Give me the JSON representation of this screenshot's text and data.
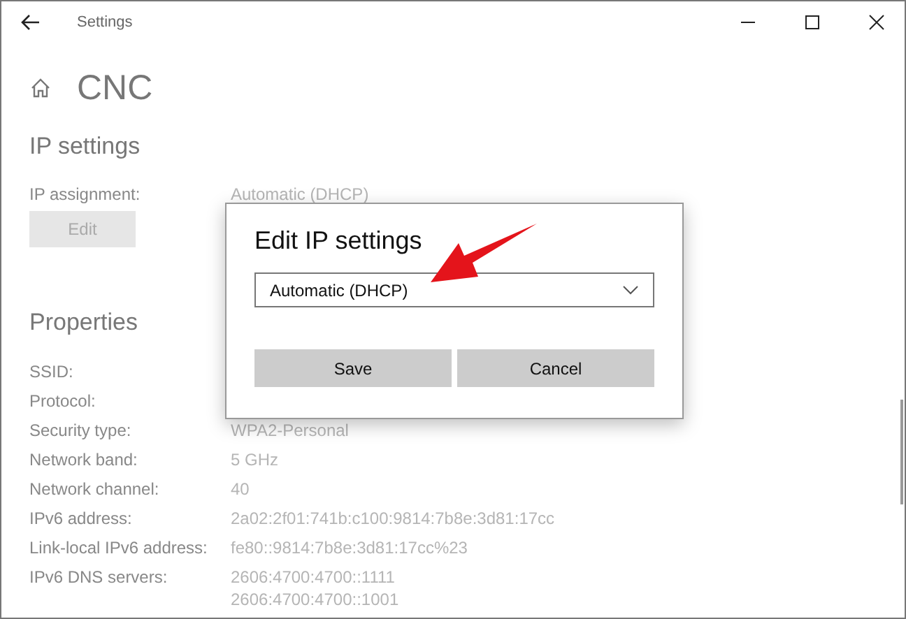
{
  "window": {
    "title": "Settings"
  },
  "page": {
    "title": "CNC"
  },
  "ip_settings": {
    "heading": "IP settings",
    "label": "IP assignment:",
    "value": "Automatic (DHCP)",
    "edit_button": "Edit"
  },
  "properties": {
    "heading": "Properties",
    "rows": [
      {
        "label": "SSID:",
        "values": []
      },
      {
        "label": "Protocol:",
        "values": []
      },
      {
        "label": "Security type:",
        "values": [
          "WPA2-Personal"
        ]
      },
      {
        "label": "Network band:",
        "values": [
          "5 GHz"
        ]
      },
      {
        "label": "Network channel:",
        "values": [
          "40"
        ]
      },
      {
        "label": "IPv6 address:",
        "values": [
          "2a02:2f01:741b:c100:9814:7b8e:3d81:17cc"
        ]
      },
      {
        "label": "Link-local IPv6 address:",
        "values": [
          "fe80::9814:7b8e:3d81:17cc%23"
        ]
      },
      {
        "label": "IPv6 DNS servers:",
        "values": [
          "2606:4700:4700::1111",
          "2606:4700:4700::1001"
        ]
      }
    ]
  },
  "dialog": {
    "title": "Edit IP settings",
    "dropdown": {
      "value": "Automatic (DHCP)",
      "expanded": false
    },
    "buttons": [
      "Save",
      "Cancel"
    ]
  }
}
